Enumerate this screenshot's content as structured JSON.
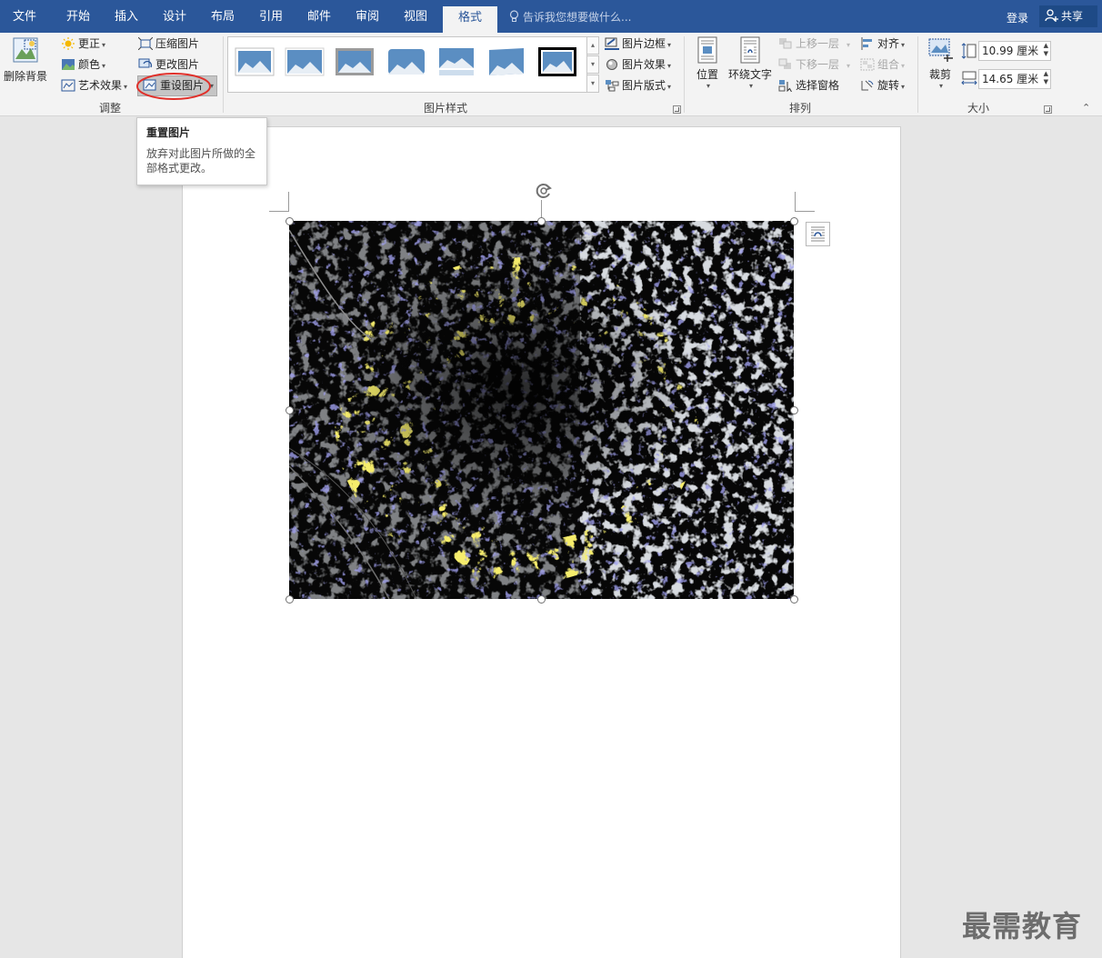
{
  "tabs": [
    {
      "label": "文件"
    },
    {
      "label": "开始"
    },
    {
      "label": "插入"
    },
    {
      "label": "设计"
    },
    {
      "label": "布局"
    },
    {
      "label": "引用"
    },
    {
      "label": "邮件"
    },
    {
      "label": "审阅"
    },
    {
      "label": "视图"
    },
    {
      "label": "格式",
      "active": true
    }
  ],
  "tell_me_placeholder": "告诉我您想要做什么...",
  "account": {
    "login": "登录",
    "share": "共享"
  },
  "ribbon": {
    "adjust": {
      "remove_background": "删除背景",
      "corrections": "更正",
      "color": "颜色",
      "artistic_effects": "艺术效果",
      "compress": "压缩图片",
      "change_picture": "更改图片",
      "reset_picture": "重设图片",
      "group_label": "调整"
    },
    "styles": {
      "border": "图片边框",
      "effects": "图片效果",
      "layout": "图片版式",
      "group_label": "图片样式"
    },
    "arrange": {
      "position": "位置",
      "wrap_text": "环绕文字",
      "bring_forward": "上移一层",
      "send_backward": "下移一层",
      "selection_pane": "选择窗格",
      "align": "对齐",
      "group": "组合",
      "rotate": "旋转",
      "group_label": "排列"
    },
    "size": {
      "crop": "裁剪",
      "height": "10.99 厘米",
      "width": "14.65 厘米",
      "group_label": "大小"
    }
  },
  "tooltip": {
    "title": "重置图片",
    "description": "放弃对此图片所做的全部格式更改。"
  },
  "watermark": "最需教育",
  "colors": {
    "accent": "#2b579a",
    "highlight_circle": "#e0302a"
  }
}
